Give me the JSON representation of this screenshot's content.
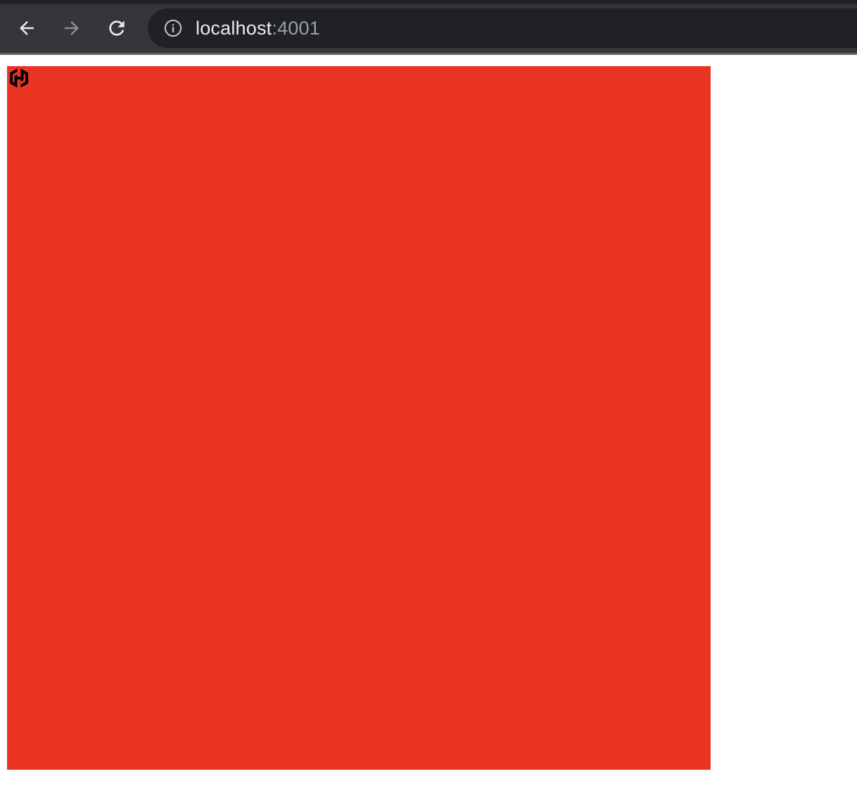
{
  "browser": {
    "url_host": "localhost",
    "url_port": ":4001",
    "icons": {
      "back": "arrow-left-icon",
      "forward": "arrow-right-icon",
      "reload": "reload-icon",
      "site_info": "info-icon"
    }
  },
  "page": {
    "square_color": "#e93323",
    "logo_icon": "hashicorp-logo-icon",
    "logo_color": "#000000"
  }
}
